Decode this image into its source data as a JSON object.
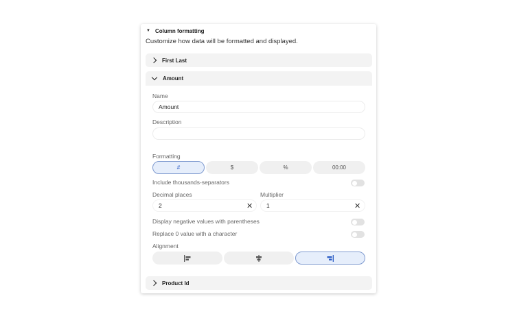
{
  "section": {
    "title": "Column formatting",
    "description": "Customize how data will be formatted and displayed."
  },
  "groups": [
    {
      "label": "First Last",
      "expanded": false
    },
    {
      "label": "Amount",
      "expanded": true
    },
    {
      "label": "Product Id",
      "expanded": false
    }
  ],
  "amount": {
    "name_label": "Name",
    "name_value": "Amount",
    "description_label": "Description",
    "description_value": "",
    "formatting_label": "Formatting",
    "formatting_options": [
      "#",
      "$",
      "%",
      "00:00"
    ],
    "formatting_selected": "#",
    "thousands_label": "Include thousands-separators",
    "thousands_on": false,
    "decimal_label": "Decimal places",
    "decimal_value": "2",
    "multiplier_label": "Multiplier",
    "multiplier_value": "1",
    "negative_label": "Display negative values with parentheses",
    "negative_on": false,
    "replace_zero_label": "Replace 0 value with a character",
    "replace_zero_on": false,
    "alignment_label": "Alignment",
    "alignment_options": [
      "align-left-icon",
      "align-center-icon",
      "align-right-icon"
    ],
    "alignment_selected": "right",
    "clear_glyph": "✕"
  },
  "colors": {
    "accent": "#2f5fc6",
    "selected_bg": "#e6eefb",
    "group_bg": "#f3f3f3"
  }
}
